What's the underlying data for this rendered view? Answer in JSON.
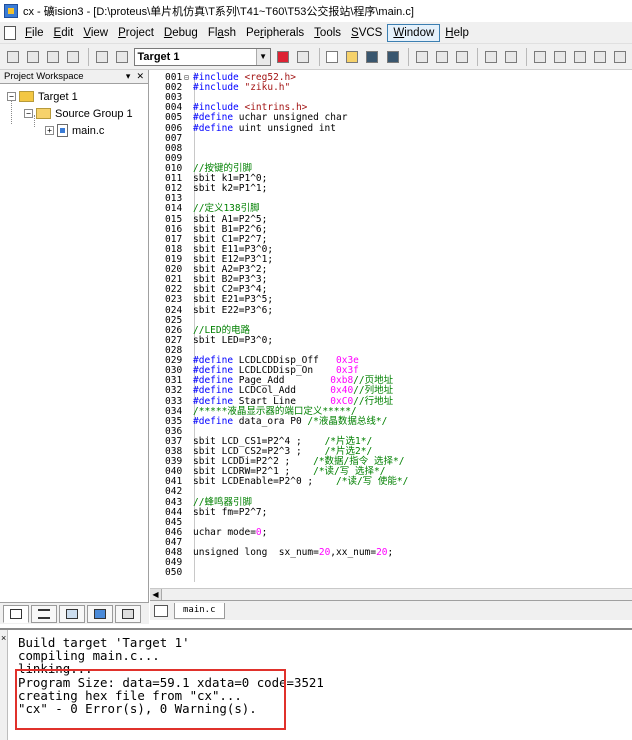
{
  "window": {
    "title": "cx - 礦ision3 - [D:\\proteus\\单片机仿真\\T系列\\T41~T60\\T53公交报站\\程序\\main.c]"
  },
  "menubar": {
    "items": [
      {
        "label": "File",
        "underline": "F"
      },
      {
        "label": "Edit",
        "underline": "E"
      },
      {
        "label": "View",
        "underline": "V"
      },
      {
        "label": "Project",
        "underline": "P"
      },
      {
        "label": "Debug",
        "underline": "D"
      },
      {
        "label": "Flash",
        "underline": "a"
      },
      {
        "label": "Peripherals",
        "underline": "r"
      },
      {
        "label": "Tools",
        "underline": "T"
      },
      {
        "label": "SVCS",
        "underline": "S"
      },
      {
        "label": "Window",
        "underline": "W",
        "active": true
      },
      {
        "label": "Help",
        "underline": "H"
      }
    ]
  },
  "toolbar": {
    "target_select": "Target 1"
  },
  "workspace": {
    "header": "Project Workspace",
    "tree": {
      "target": "Target 1",
      "group": "Source Group 1",
      "file": "main.c"
    }
  },
  "editor": {
    "lines": [
      {
        "n": "001",
        "fold": "⊟",
        "parts": [
          [
            "kw",
            "#include "
          ],
          [
            "str",
            "<reg52.h>"
          ]
        ]
      },
      {
        "n": "002",
        "parts": [
          [
            "kw",
            "#include "
          ],
          [
            "str",
            "\"ziku.h\""
          ]
        ]
      },
      {
        "n": "003",
        "parts": []
      },
      {
        "n": "004",
        "parts": [
          [
            "kw",
            "#include "
          ],
          [
            "str",
            "<intrins.h>"
          ]
        ]
      },
      {
        "n": "005",
        "parts": [
          [
            "kw",
            "#define "
          ],
          [
            "t",
            "uchar unsigned char"
          ]
        ]
      },
      {
        "n": "006",
        "parts": [
          [
            "kw",
            "#define "
          ],
          [
            "t",
            "uint unsigned int"
          ]
        ]
      },
      {
        "n": "007",
        "parts": []
      },
      {
        "n": "008",
        "parts": []
      },
      {
        "n": "009",
        "parts": []
      },
      {
        "n": "010",
        "parts": [
          [
            "com",
            "//按键的引脚"
          ]
        ]
      },
      {
        "n": "011",
        "parts": [
          [
            "t",
            "sbit k1=P1^0;"
          ]
        ]
      },
      {
        "n": "012",
        "parts": [
          [
            "t",
            "sbit k2=P1^1;"
          ]
        ]
      },
      {
        "n": "013",
        "parts": []
      },
      {
        "n": "014",
        "parts": [
          [
            "com",
            "//定义138引脚"
          ]
        ]
      },
      {
        "n": "015",
        "parts": [
          [
            "t",
            "sbit A1=P2^5;"
          ]
        ]
      },
      {
        "n": "016",
        "parts": [
          [
            "t",
            "sbit B1=P2^6;"
          ]
        ]
      },
      {
        "n": "017",
        "parts": [
          [
            "t",
            "sbit C1=P2^7;"
          ]
        ]
      },
      {
        "n": "018",
        "parts": [
          [
            "t",
            "sbit E11=P3^0;"
          ]
        ]
      },
      {
        "n": "019",
        "parts": [
          [
            "t",
            "sbit E12=P3^1;"
          ]
        ]
      },
      {
        "n": "020",
        "parts": [
          [
            "t",
            "sbit A2=P3^2;"
          ]
        ]
      },
      {
        "n": "021",
        "parts": [
          [
            "t",
            "sbit B2=P3^3;"
          ]
        ]
      },
      {
        "n": "022",
        "parts": [
          [
            "t",
            "sbit C2=P3^4;"
          ]
        ]
      },
      {
        "n": "023",
        "parts": [
          [
            "t",
            "sbit E21=P3^5;"
          ]
        ]
      },
      {
        "n": "024",
        "parts": [
          [
            "t",
            "sbit E22=P3^6;"
          ]
        ]
      },
      {
        "n": "025",
        "parts": []
      },
      {
        "n": "026",
        "parts": [
          [
            "com",
            "//LED的电路"
          ]
        ]
      },
      {
        "n": "027",
        "parts": [
          [
            "t",
            "sbit LED=P3^0;"
          ]
        ]
      },
      {
        "n": "028",
        "parts": []
      },
      {
        "n": "029",
        "parts": [
          [
            "kw",
            "#define "
          ],
          [
            "t",
            "LCDLCDDisp_Off   "
          ],
          [
            "hex",
            "0x3e"
          ]
        ]
      },
      {
        "n": "030",
        "parts": [
          [
            "kw",
            "#define "
          ],
          [
            "t",
            "LCDLCDDisp_On    "
          ],
          [
            "hex",
            "0x3f"
          ]
        ]
      },
      {
        "n": "031",
        "parts": [
          [
            "kw",
            "#define "
          ],
          [
            "t",
            "Page_Add        "
          ],
          [
            "hex",
            "0xb8"
          ],
          [
            "com",
            "//页地址"
          ]
        ]
      },
      {
        "n": "032",
        "parts": [
          [
            "kw",
            "#define "
          ],
          [
            "t",
            "LCDCol_Add      "
          ],
          [
            "hex",
            "0x40"
          ],
          [
            "com",
            "//列地址"
          ]
        ]
      },
      {
        "n": "033",
        "parts": [
          [
            "kw",
            "#define "
          ],
          [
            "t",
            "Start_Line      "
          ],
          [
            "hex",
            "0xC0"
          ],
          [
            "com",
            "//行地址"
          ]
        ]
      },
      {
        "n": "034",
        "parts": [
          [
            "com",
            "/*****液晶显示器的端口定义*****/"
          ]
        ]
      },
      {
        "n": "035",
        "parts": [
          [
            "kw",
            "#define "
          ],
          [
            "t",
            "data_ora P0 "
          ],
          [
            "com",
            "/*液晶数据总线*/"
          ]
        ]
      },
      {
        "n": "036",
        "parts": []
      },
      {
        "n": "037",
        "parts": [
          [
            "t",
            "sbit LCD_CS1=P2^4 ;    "
          ],
          [
            "com",
            "/*片选1*/"
          ]
        ]
      },
      {
        "n": "038",
        "parts": [
          [
            "t",
            "sbit LCD_CS2=P2^3 ;    "
          ],
          [
            "com",
            "/*片选2*/"
          ]
        ]
      },
      {
        "n": "039",
        "parts": [
          [
            "t",
            "sbit LCDDi=P2^2 ;    "
          ],
          [
            "com",
            "/*数据/指令 选择*/"
          ]
        ]
      },
      {
        "n": "040",
        "parts": [
          [
            "t",
            "sbit LCDRW=P2^1 ;    "
          ],
          [
            "com",
            "/*读/写 选择*/"
          ]
        ]
      },
      {
        "n": "041",
        "parts": [
          [
            "t",
            "sbit LCDEnable=P2^0 ;    "
          ],
          [
            "com",
            "/*读/写 使能*/"
          ]
        ]
      },
      {
        "n": "042",
        "parts": []
      },
      {
        "n": "043",
        "parts": [
          [
            "com",
            "//蜂鸣器引脚"
          ]
        ]
      },
      {
        "n": "044",
        "parts": [
          [
            "t",
            "sbit fm=P2^7;"
          ]
        ]
      },
      {
        "n": "045",
        "parts": []
      },
      {
        "n": "046",
        "parts": [
          [
            "t",
            "uchar mode="
          ],
          [
            "num",
            "0"
          ],
          [
            "t",
            ";"
          ]
        ]
      },
      {
        "n": "047",
        "parts": []
      },
      {
        "n": "048",
        "parts": [
          [
            "t",
            "unsigned long  sx_num="
          ],
          [
            "num",
            "20"
          ],
          [
            "t",
            ",xx_num="
          ],
          [
            "num",
            "20"
          ],
          [
            "t",
            ";"
          ]
        ]
      },
      {
        "n": "049",
        "parts": []
      },
      {
        "n": "050",
        "parts": []
      }
    ]
  },
  "file_tab": "main.c",
  "build_output": {
    "lines": [
      "Build target 'Target 1'",
      "compiling main.c...",
      "linking...",
      "Program Size: data=59.1 xdata=0 code=3521",
      "creating hex file from \"cx\"...",
      "\"cx\" - 0 Error(s), 0 Warning(s)."
    ]
  },
  "colors": {
    "keyword": "#0000ff",
    "string": "#a31515",
    "comment": "#008000",
    "number": "#ff00ff",
    "highlight_box": "#e0312b"
  }
}
